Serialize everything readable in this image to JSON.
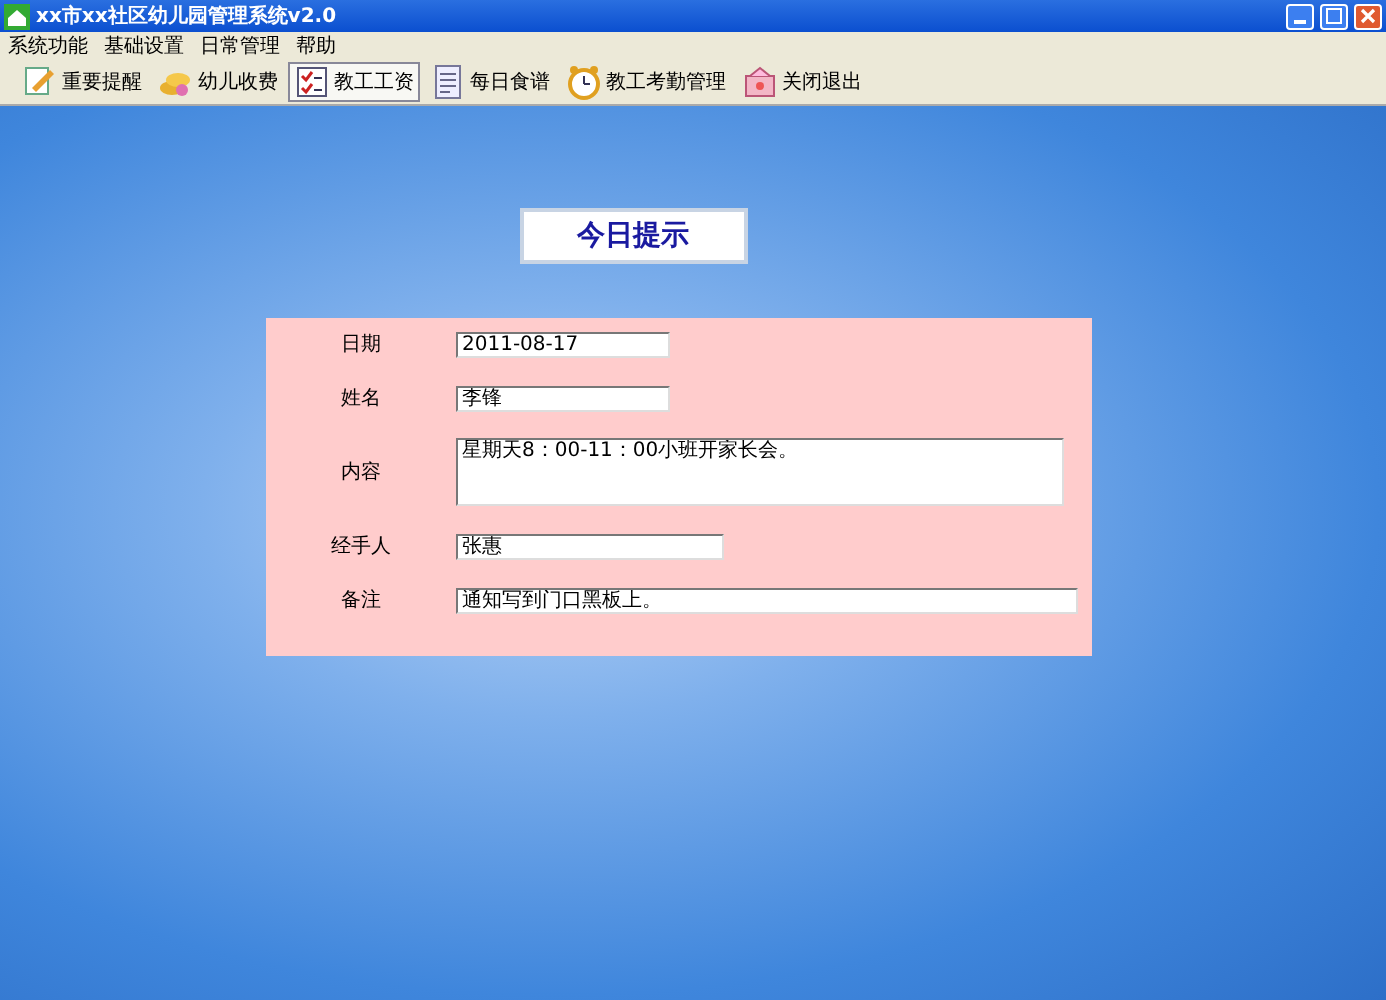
{
  "window": {
    "title": "xx市xx社区幼儿园管理系统v2.0"
  },
  "menu": [
    "系统功能",
    "基础设置",
    "日常管理",
    "帮助"
  ],
  "toolbar": [
    {
      "label": "重要提醒",
      "kind": "memo",
      "selected": false
    },
    {
      "label": "幼儿收费",
      "kind": "coins",
      "selected": false
    },
    {
      "label": "教工工资",
      "kind": "checklist",
      "selected": true
    },
    {
      "label": "每日食谱",
      "kind": "sheet",
      "selected": false
    },
    {
      "label": "教工考勤管理",
      "kind": "clock",
      "selected": false
    },
    {
      "label": "关闭退出",
      "kind": "exit",
      "selected": false
    }
  ],
  "heading": "今日提示",
  "form": [
    {
      "label": "日期",
      "value": "2011-08-17",
      "kind": "short"
    },
    {
      "label": "姓名",
      "value": "李锋",
      "kind": "short"
    },
    {
      "label": "内容",
      "value": "星期天8：00-11：00小班开家长会。",
      "kind": "multiline"
    },
    {
      "label": "经手人",
      "value": "张惠",
      "kind": "medium"
    },
    {
      "label": "备注",
      "value": "通知写到门口黑板上。",
      "kind": "long"
    }
  ]
}
